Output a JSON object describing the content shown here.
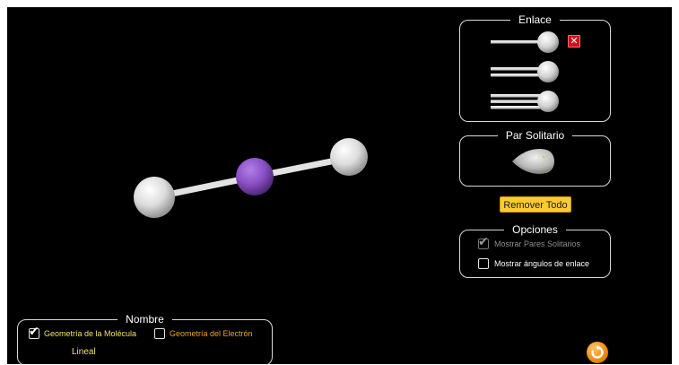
{
  "bond_panel": {
    "title": "Enlace",
    "bonds": [
      {
        "name": "single-bond",
        "lines": 1
      },
      {
        "name": "double-bond",
        "lines": 2
      },
      {
        "name": "triple-bond",
        "lines": 3
      }
    ],
    "remove_icon": "x-icon"
  },
  "lone_pair_panel": {
    "title": "Par Solitario"
  },
  "remove_all_label": "Remover Todo",
  "options_panel": {
    "title": "Opciones",
    "show_lone_pairs": "Mostrar Pares Solitarios",
    "show_lone_pairs_checked": true,
    "show_lone_pairs_enabled": false,
    "show_bond_angles": "Mostrar ángulos de enlace",
    "show_bond_angles_checked": false
  },
  "name_panel": {
    "title": "Nombre",
    "molecule_geometry_label": "Geometría de la Molécula",
    "molecule_geometry_checked": true,
    "electron_geometry_label": "Geometría del Electrón",
    "electron_geometry_checked": false,
    "molecule_geometry_value": "Lineal"
  },
  "colors": {
    "background": "#000000",
    "central_atom": "#8a4fc4",
    "outer_atom": "#e8e8e8",
    "molecule_label": "#f5e066",
    "electron_label": "#f0a030",
    "accent_button": "#fccb30",
    "reset_button": "#f08a0a"
  },
  "icons": {
    "reset": "reset-icon",
    "check": "check-icon"
  }
}
